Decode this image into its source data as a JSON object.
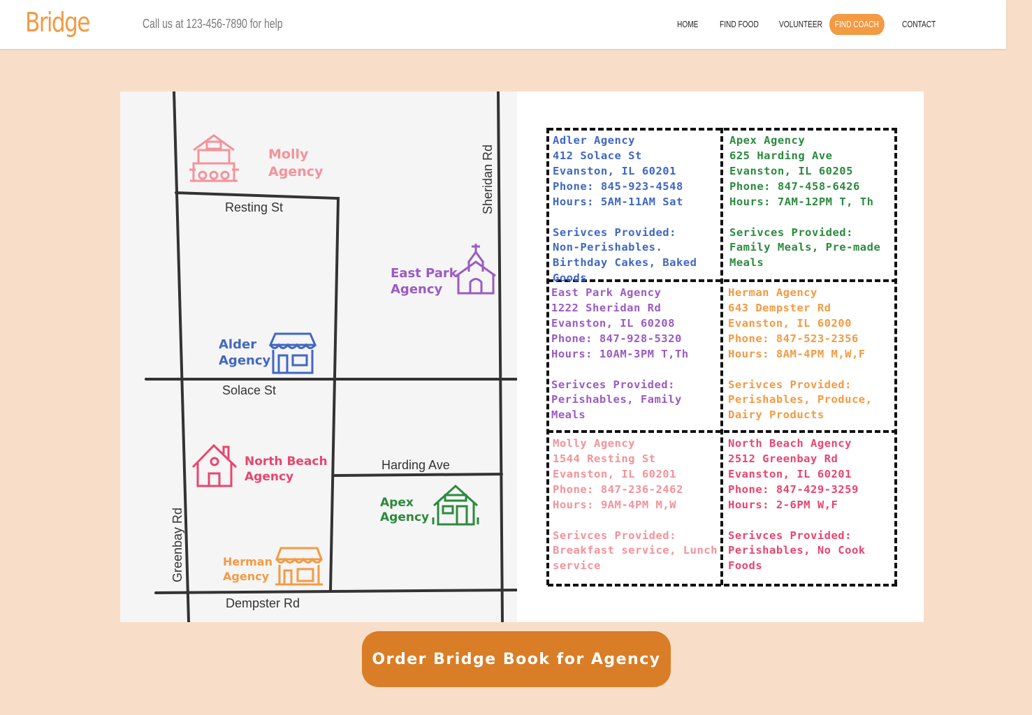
{
  "header": {
    "logo": "Bridge",
    "helpline": "Call us at 123-456-7890 for help",
    "nav": [
      "HOME",
      "FIND FOOD",
      "VOLUNTEER",
      "FIND COACH",
      "CONTACT"
    ],
    "active_nav": "FIND COACH",
    "accent_color": "#f39a43"
  },
  "map": {
    "streets": {
      "resting": "Resting St",
      "solace": "Solace St",
      "harding": "Harding Ave",
      "dempster": "Dempster Rd",
      "sheridan": "Sheridan Rd",
      "greenbay": "Greenbay Rd"
    },
    "labels": {
      "molly": [
        "Molly",
        "Agency"
      ],
      "east_park": [
        "East Park",
        "Agency"
      ],
      "alder": [
        "Alder",
        "Agency"
      ],
      "north_beach": [
        "North Beach",
        "Agency"
      ],
      "apex": [
        "Apex",
        "Agency"
      ],
      "herman": [
        "Herman",
        "Agency"
      ]
    },
    "icons": [
      "house-hall-icon",
      "church-icon",
      "storefront-icon",
      "house-icon",
      "house-icon",
      "market-stall-icon"
    ]
  },
  "agencies": [
    {
      "name": "Adler Agency",
      "address": "412 Solace St",
      "city": "Evanston, IL 60201",
      "phone": "Phone: 845-923-4548",
      "hours": "Hours: 5AM-11AM Sat",
      "services_label": "Serivces Provided:",
      "services": "Non-Perishables. Birthday Cakes, Baked Goods",
      "color": "#3f67c4"
    },
    {
      "name": "Apex Agency",
      "address": "625 Harding Ave",
      "city": "Evanston, IL 60205",
      "phone": "Phone: 847-458-6426",
      "hours": "Hours: 7AM-12PM T, Th",
      "services_label": "Serivces Provided:",
      "services": "Family Meals, Pre-made Meals",
      "color": "#2b8a3e"
    },
    {
      "name": "East Park Agency",
      "address": "1222 Sheridan Rd",
      "city": "Evanston, IL 60208",
      "phone": "Phone: 847-928-5320",
      "hours": "Hours: 10AM-3PM T,Th",
      "services_label": "Serivces Provided:",
      "services": "Perishables, Family Meals",
      "color": "#9a5bc2"
    },
    {
      "name": "Herman Agency",
      "address": "643 Dempster Rd",
      "city": "Evanston, IL 60200",
      "phone": "Phone: 847-523-2356",
      "hours": "Hours: 8AM-4PM M,W,F",
      "services_label": "Serivces Provided:",
      "services": "Perishables, Produce, Dairy Products",
      "color": "#f39a43"
    },
    {
      "name": "Molly Agency",
      "address": "1544 Resting St",
      "city": "Evanston, IL 60201",
      "phone": "Phone: 847-236-2462",
      "hours": "Hours: 9AM-4PM M,W",
      "services_label": "Serivces Provided:",
      "services": "Breakfast service, Lunch service",
      "color": "#f4929a"
    },
    {
      "name": "North Beach Agency",
      "address": "2512 Greenbay Rd",
      "city": "Evanston, IL 60201",
      "phone": "Phone: 847-429-3259",
      "hours": "Hours: 2-6PM W,F",
      "services_label": "Serivces Provided:",
      "services": "Perishables, No Cook Foods",
      "color": "#e8456e"
    }
  ],
  "cta": {
    "label": "Order Bridge Book for Agency",
    "color": "#d97d27"
  }
}
